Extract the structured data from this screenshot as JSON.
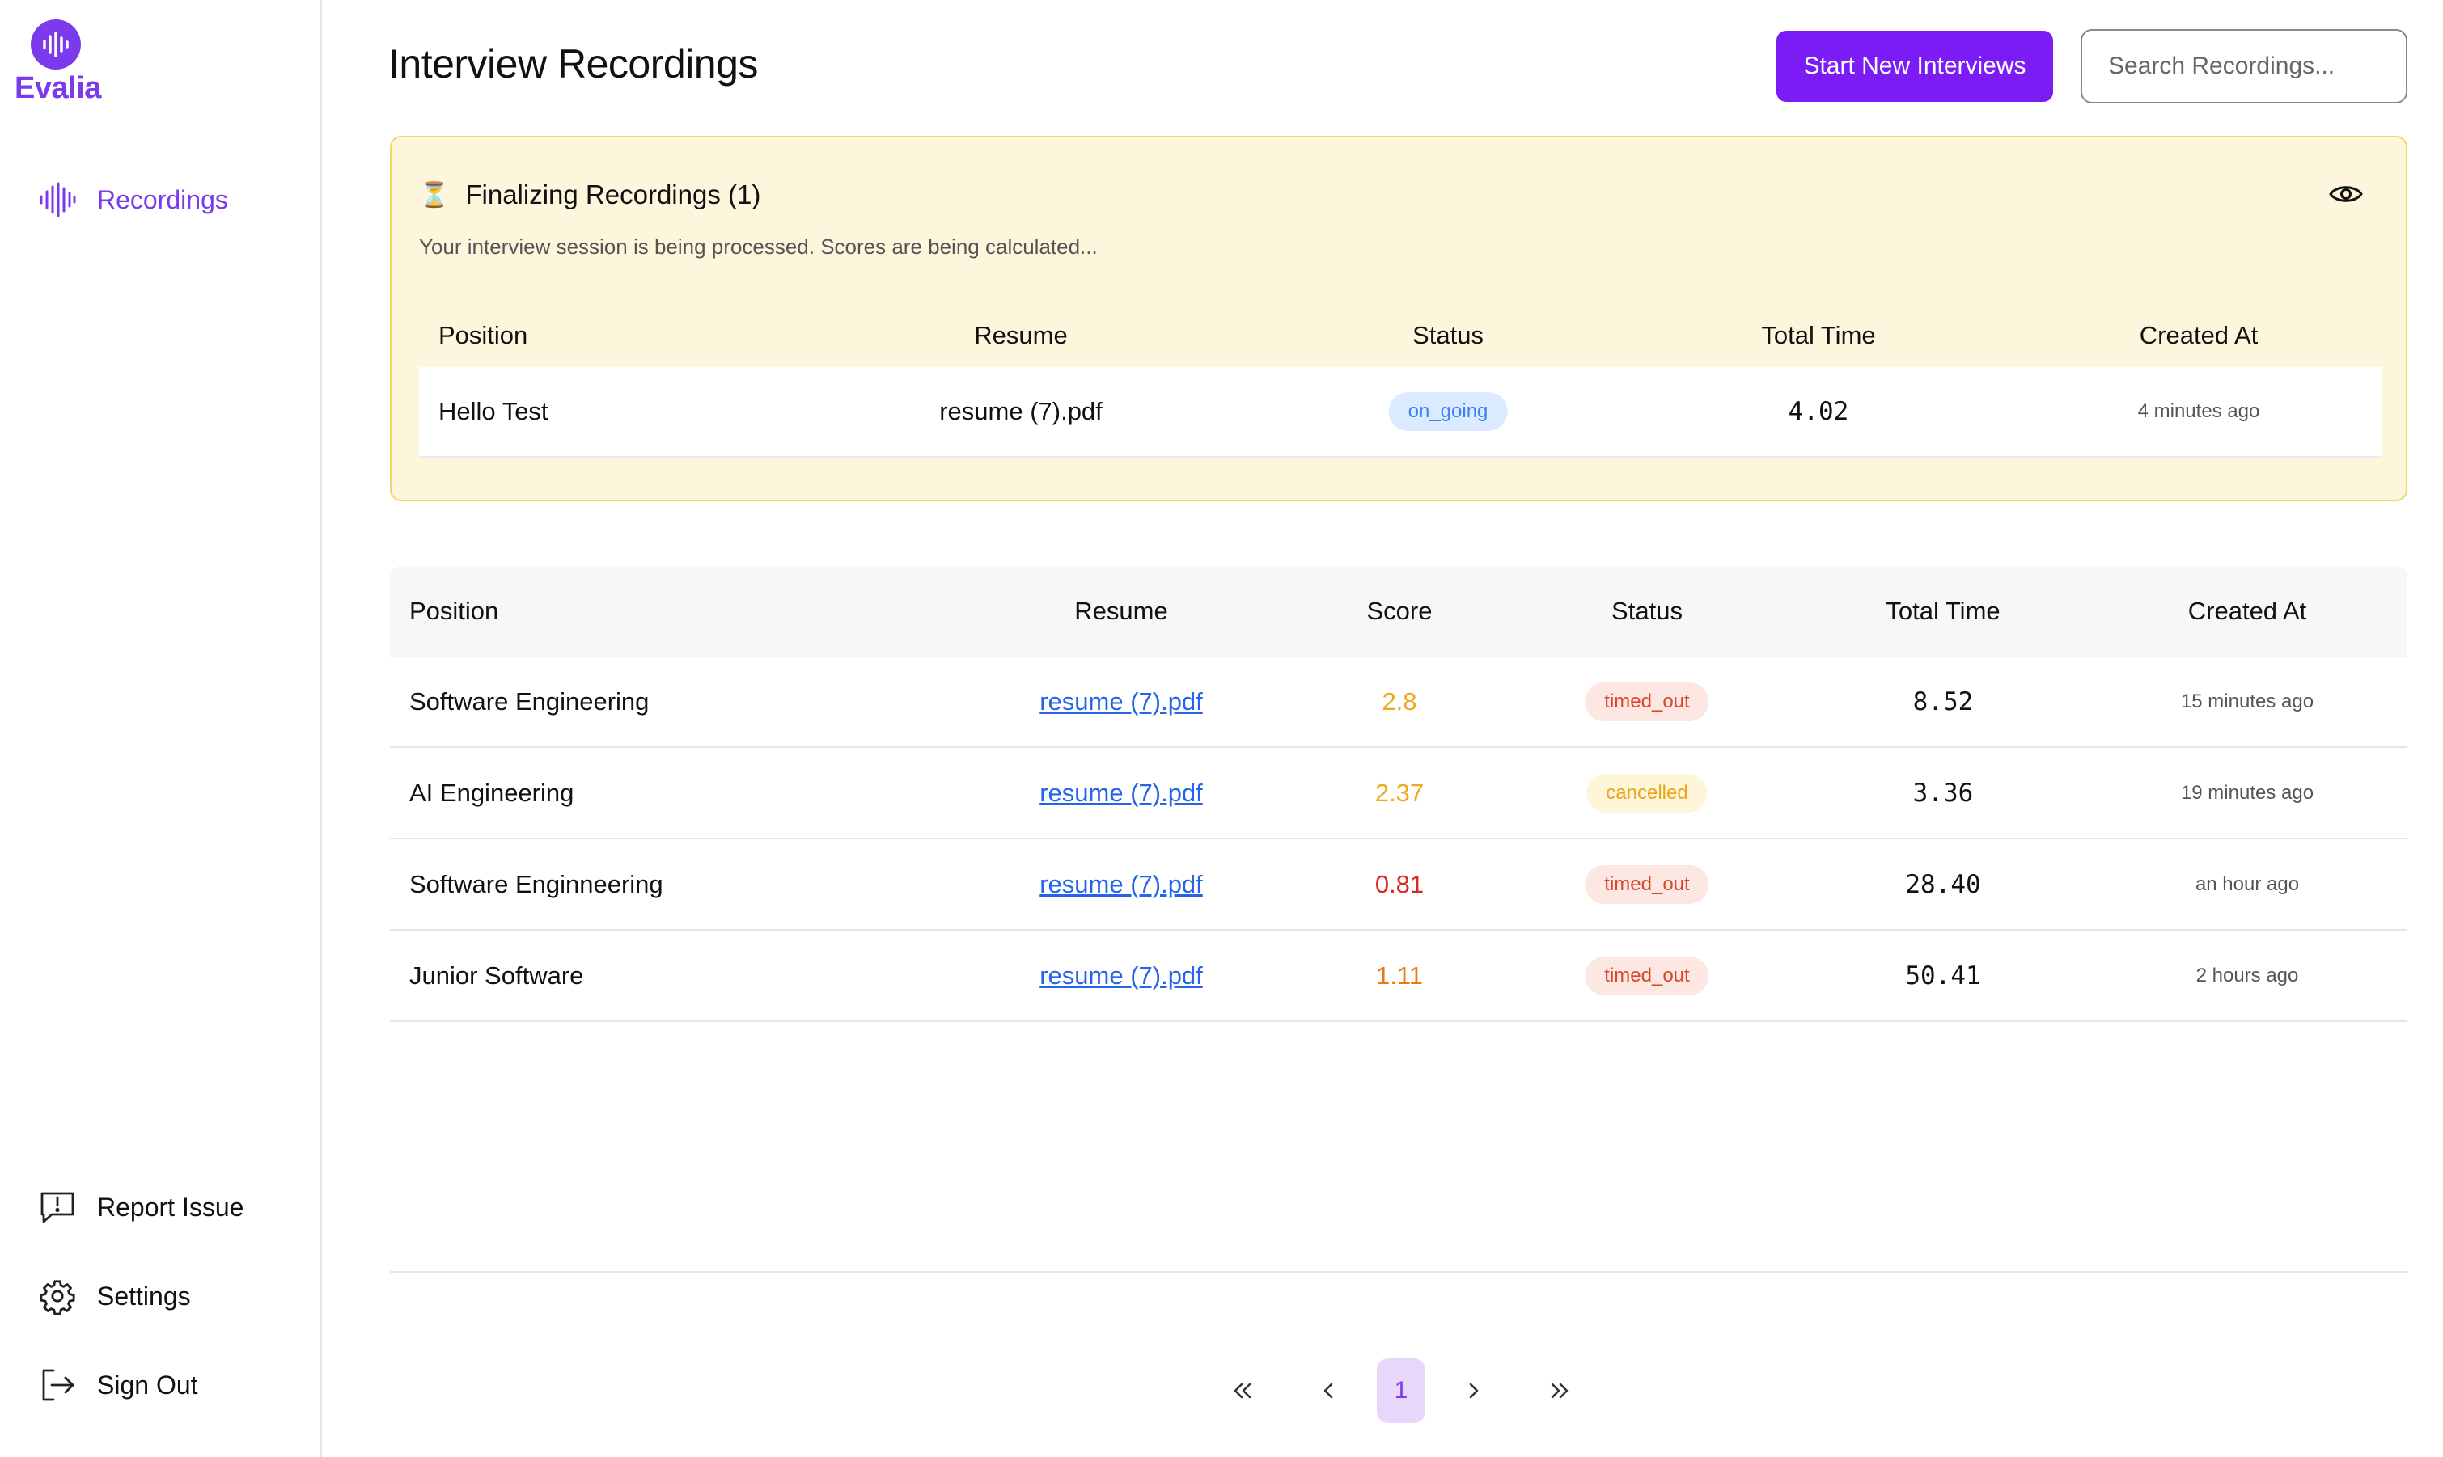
{
  "app": {
    "name": "Evalia"
  },
  "sidebar": {
    "nav": [
      {
        "label": "Recordings",
        "icon": "audio-waveform-icon",
        "active": true
      }
    ],
    "footer": [
      {
        "label": "Report Issue",
        "icon": "report-issue-icon"
      },
      {
        "label": "Settings",
        "icon": "gear-icon"
      },
      {
        "label": "Sign Out",
        "icon": "sign-out-icon"
      }
    ]
  },
  "header": {
    "title": "Interview Recordings",
    "primary_button": "Start New Interviews",
    "search_placeholder": "Search Recordings..."
  },
  "finalizing": {
    "icon": "⏳",
    "title": "Finalizing Recordings (1)",
    "subtitle": "Your interview session is being processed. Scores are being calculated...",
    "columns": [
      "Position",
      "Resume",
      "Status",
      "Total Time",
      "Created At"
    ],
    "rows": [
      {
        "position": "Hello Test",
        "resume": "resume (7).pdf",
        "status": "on_going",
        "total_time": "4.02",
        "created_at": "4 minutes ago"
      }
    ]
  },
  "recordings": {
    "columns": [
      "Position",
      "Resume",
      "Score",
      "Status",
      "Total Time",
      "Created At"
    ],
    "rows": [
      {
        "position": "Software Engineering",
        "resume": "resume (7).pdf",
        "score": "2.8",
        "score_color": "#f0a81c",
        "status": "timed_out",
        "total_time": "8.52",
        "created_at": "15 minutes ago"
      },
      {
        "position": "AI Engineering",
        "resume": "resume (7).pdf",
        "score": "2.37",
        "score_color": "#f0a81c",
        "status": "cancelled",
        "total_time": "3.36",
        "created_at": "19 minutes ago"
      },
      {
        "position": "Software Enginneering",
        "resume": "resume (7).pdf",
        "score": "0.81",
        "score_color": "#dc2626",
        "status": "timed_out",
        "total_time": "28.40",
        "created_at": "an hour ago"
      },
      {
        "position": "Junior Software",
        "resume": "resume (7).pdf",
        "score": "1.11",
        "score_color": "#ea7a14",
        "status": "timed_out",
        "total_time": "50.41",
        "created_at": "2 hours ago"
      }
    ]
  },
  "pagination": {
    "current_page": "1"
  },
  "colors": {
    "accent": "#7c3aed",
    "button": "#7c1cf4",
    "panel_bg": "#fef6dc",
    "panel_border": "#f1d76a"
  }
}
